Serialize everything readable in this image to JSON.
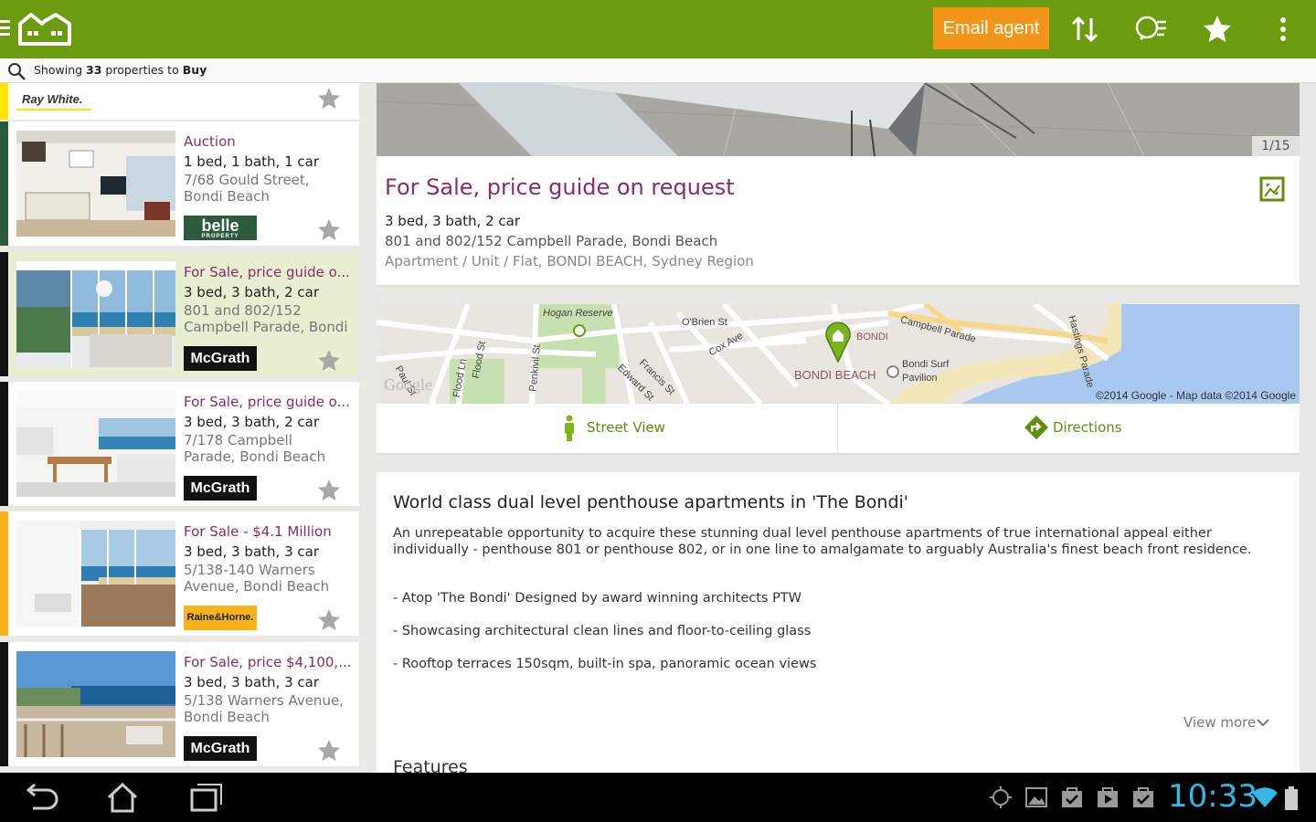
{
  "topbar": {
    "bg_color": "#6b9c10",
    "email_agent_label": "Email agent",
    "email_agent_color": "#f29519",
    "icons": [
      "menu-icon",
      "app-logo-house-icon",
      "sort-icon",
      "filter-icon",
      "star-icon",
      "overflow-menu-icon"
    ]
  },
  "summary": {
    "prefix": "Showing ",
    "count": "33",
    "middle": " properties to ",
    "mode": "Buy"
  },
  "top_partial_listing": {
    "agency": "Ray White.",
    "bar_color": "#ffe600"
  },
  "listings": [
    {
      "price": "Auction",
      "beds": "1 bed, 1 bath, 1 car",
      "address": "7/68 Gould Street, Bondi Beach",
      "agency": "belle",
      "agency_sub": "PROPERTY",
      "bar_color": "#2d5a3a"
    },
    {
      "price": "For Sale, price guide o...",
      "beds": "3 bed, 3 bath, 2 car",
      "address": "801 and 802/152 Campbell Parade, Bondi",
      "agency": "McGrath",
      "bar_color": "#111111",
      "active": true
    },
    {
      "price": "For Sale, price guide o...",
      "beds": "3 bed, 3 bath, 2 car",
      "address": "7/178 Campbell Parade, Bondi Beach",
      "agency": "McGrath",
      "bar_color": "#111111"
    },
    {
      "price": "For Sale - $4.1 Million",
      "beds": "3 bed, 3 bath, 3 car",
      "address": "5/138-140 Warners Avenue, Bondi Beach",
      "agency": "Raine&Horne.",
      "bar_color": "#f7b21c"
    },
    {
      "price": "For Sale, price $4,100,...",
      "beds": "3 bed, 3 bath, 3 car",
      "address": "5/138 Warners Avenue, Bondi Beach",
      "agency": "McGrath",
      "bar_color": "#111111"
    }
  ],
  "detail": {
    "photo_counter": "1/15",
    "price": "For Sale, price guide on request",
    "beds": "3 bed, 3 bath, 2 car",
    "address": "801 and 802/152 Campbell Parade, Bondi Beach",
    "type": "Apartment / Unit / Flat, BONDI BEACH, Sydney Region",
    "map": {
      "labels": {
        "hogan": "Hogan Reserve",
        "obrien": "O'Brien St",
        "cox": "Cox Ave",
        "campbell": "Campbell Parade",
        "hastings": "Hastings Parade",
        "bondi": "BONDI",
        "bondi_beach": "BONDI BEACH",
        "pavilion": "Bondi Surf Pavilion",
        "paul": "Paul St",
        "flood_ln": "Flood Ln",
        "flood_st": "Flood St",
        "penkivil": "Penkivil St",
        "edward": "Edward St",
        "francis": "Francis St"
      },
      "logo": "Google",
      "attribution": "©2014 Google - Map data ©2014 Google"
    },
    "street_view_label": "Street View",
    "directions_label": "Directions",
    "description": {
      "title": "World class dual level penthouse apartments in 'The Bondi'",
      "body": "An unrepeatable opportunity to acquire these stunning dual level penthouse apartments of true international appeal either individually - penthouse 801 or penthouse 802, or in one line to amalgamate to arguably Australia's finest beach front residence.",
      "bullets": [
        "- Atop 'The Bondi'  Designed by award winning architects PTW",
        "- Showcasing architectural clean lines and floor-to-ceiling glass",
        "- Rooftop terraces 150sqm, built-in spa, panoramic ocean views"
      ],
      "view_more": "View more"
    },
    "features_heading": "Features"
  },
  "system_bar": {
    "time": "10:33",
    "clock_color": "#33b5e5"
  }
}
